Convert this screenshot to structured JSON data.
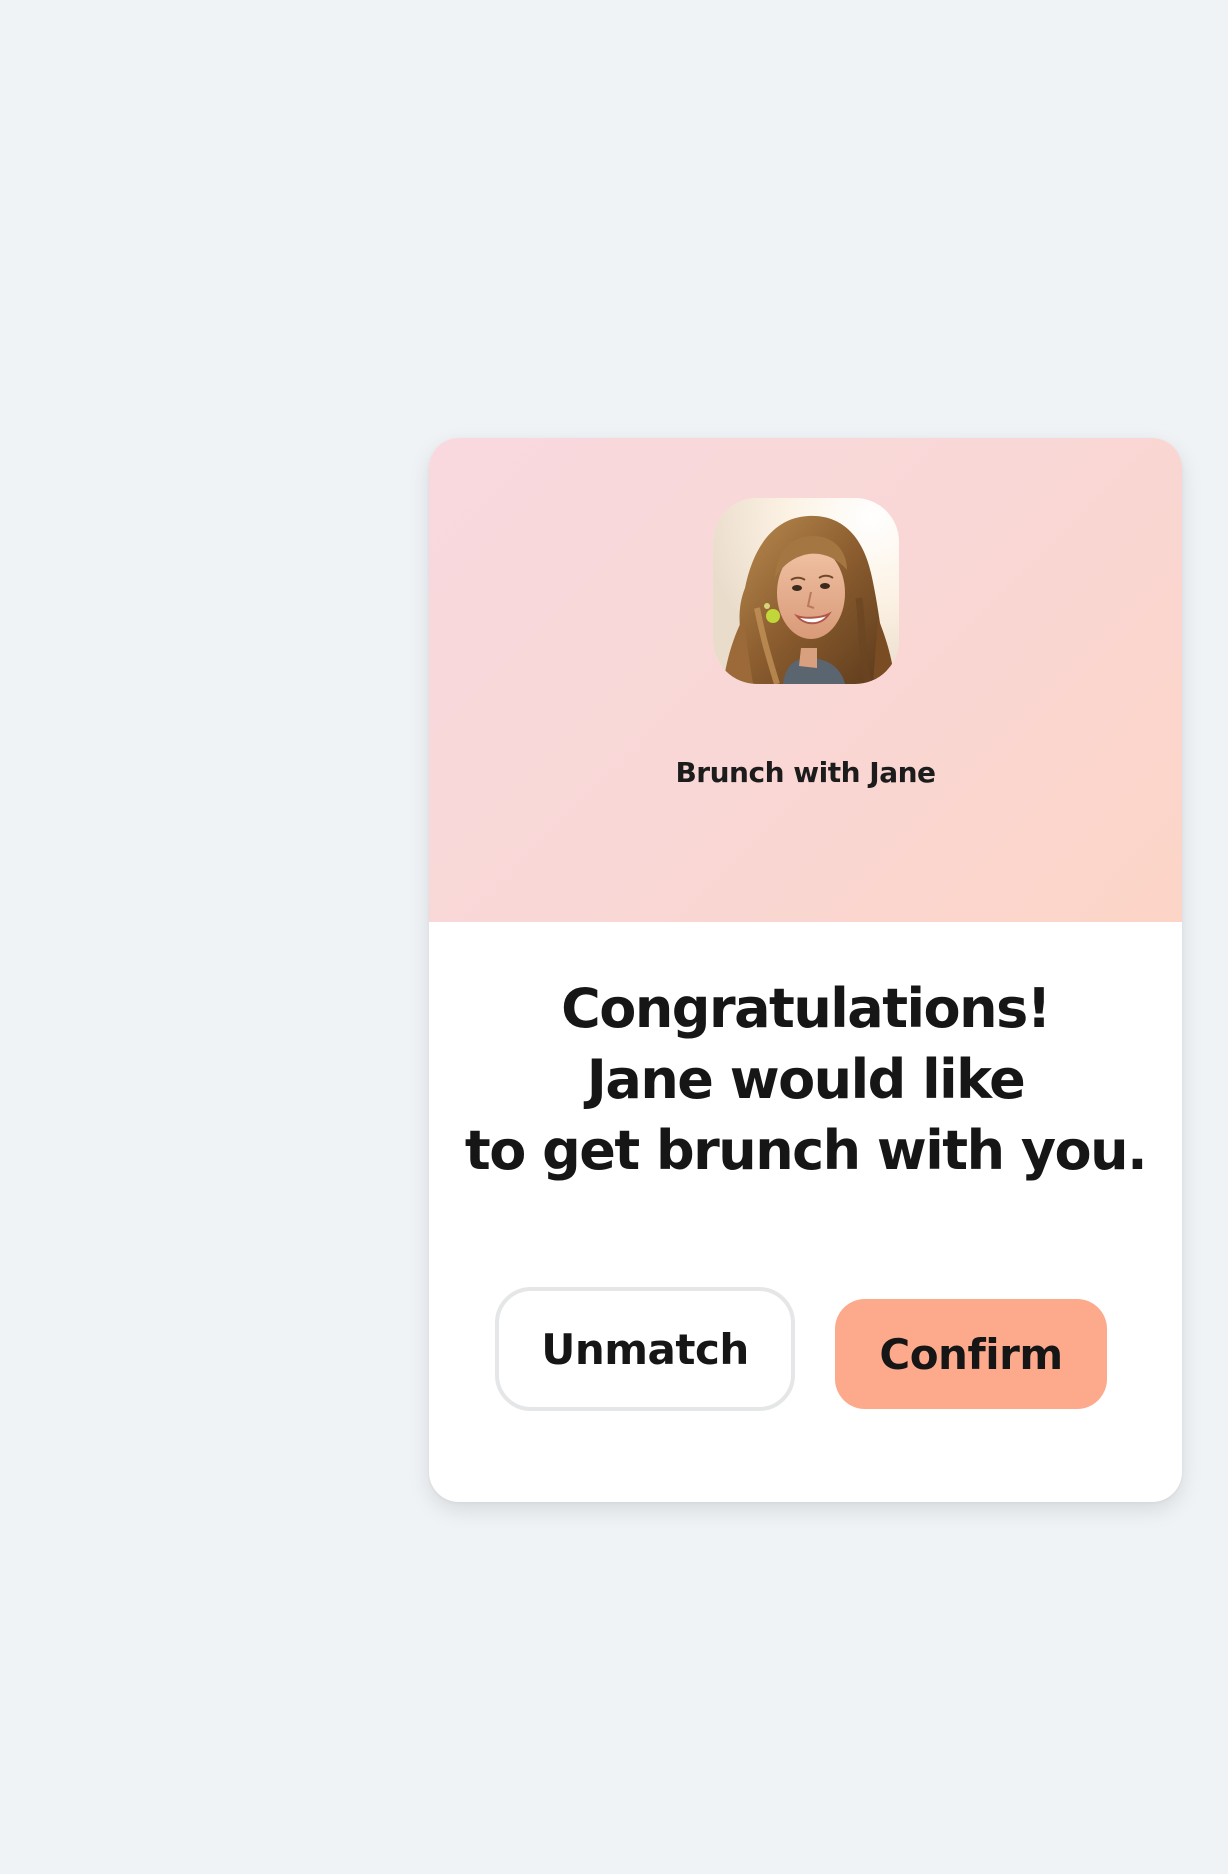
{
  "card": {
    "header_title": "Brunch with Jane",
    "avatar_alt": "Jane",
    "message_lines": [
      "Congratulations!",
      "Jane would like",
      "to get brunch with you."
    ],
    "unmatch_label": "Unmatch",
    "confirm_label": "Confirm"
  },
  "colors": {
    "page_background": "#eff3f6",
    "header_gradient_start": "#f9d9df",
    "header_gradient_end": "#fdd5c7",
    "confirm_button": "#fda98b",
    "unmatch_border": "#e4e6e8",
    "text": "#161616"
  }
}
